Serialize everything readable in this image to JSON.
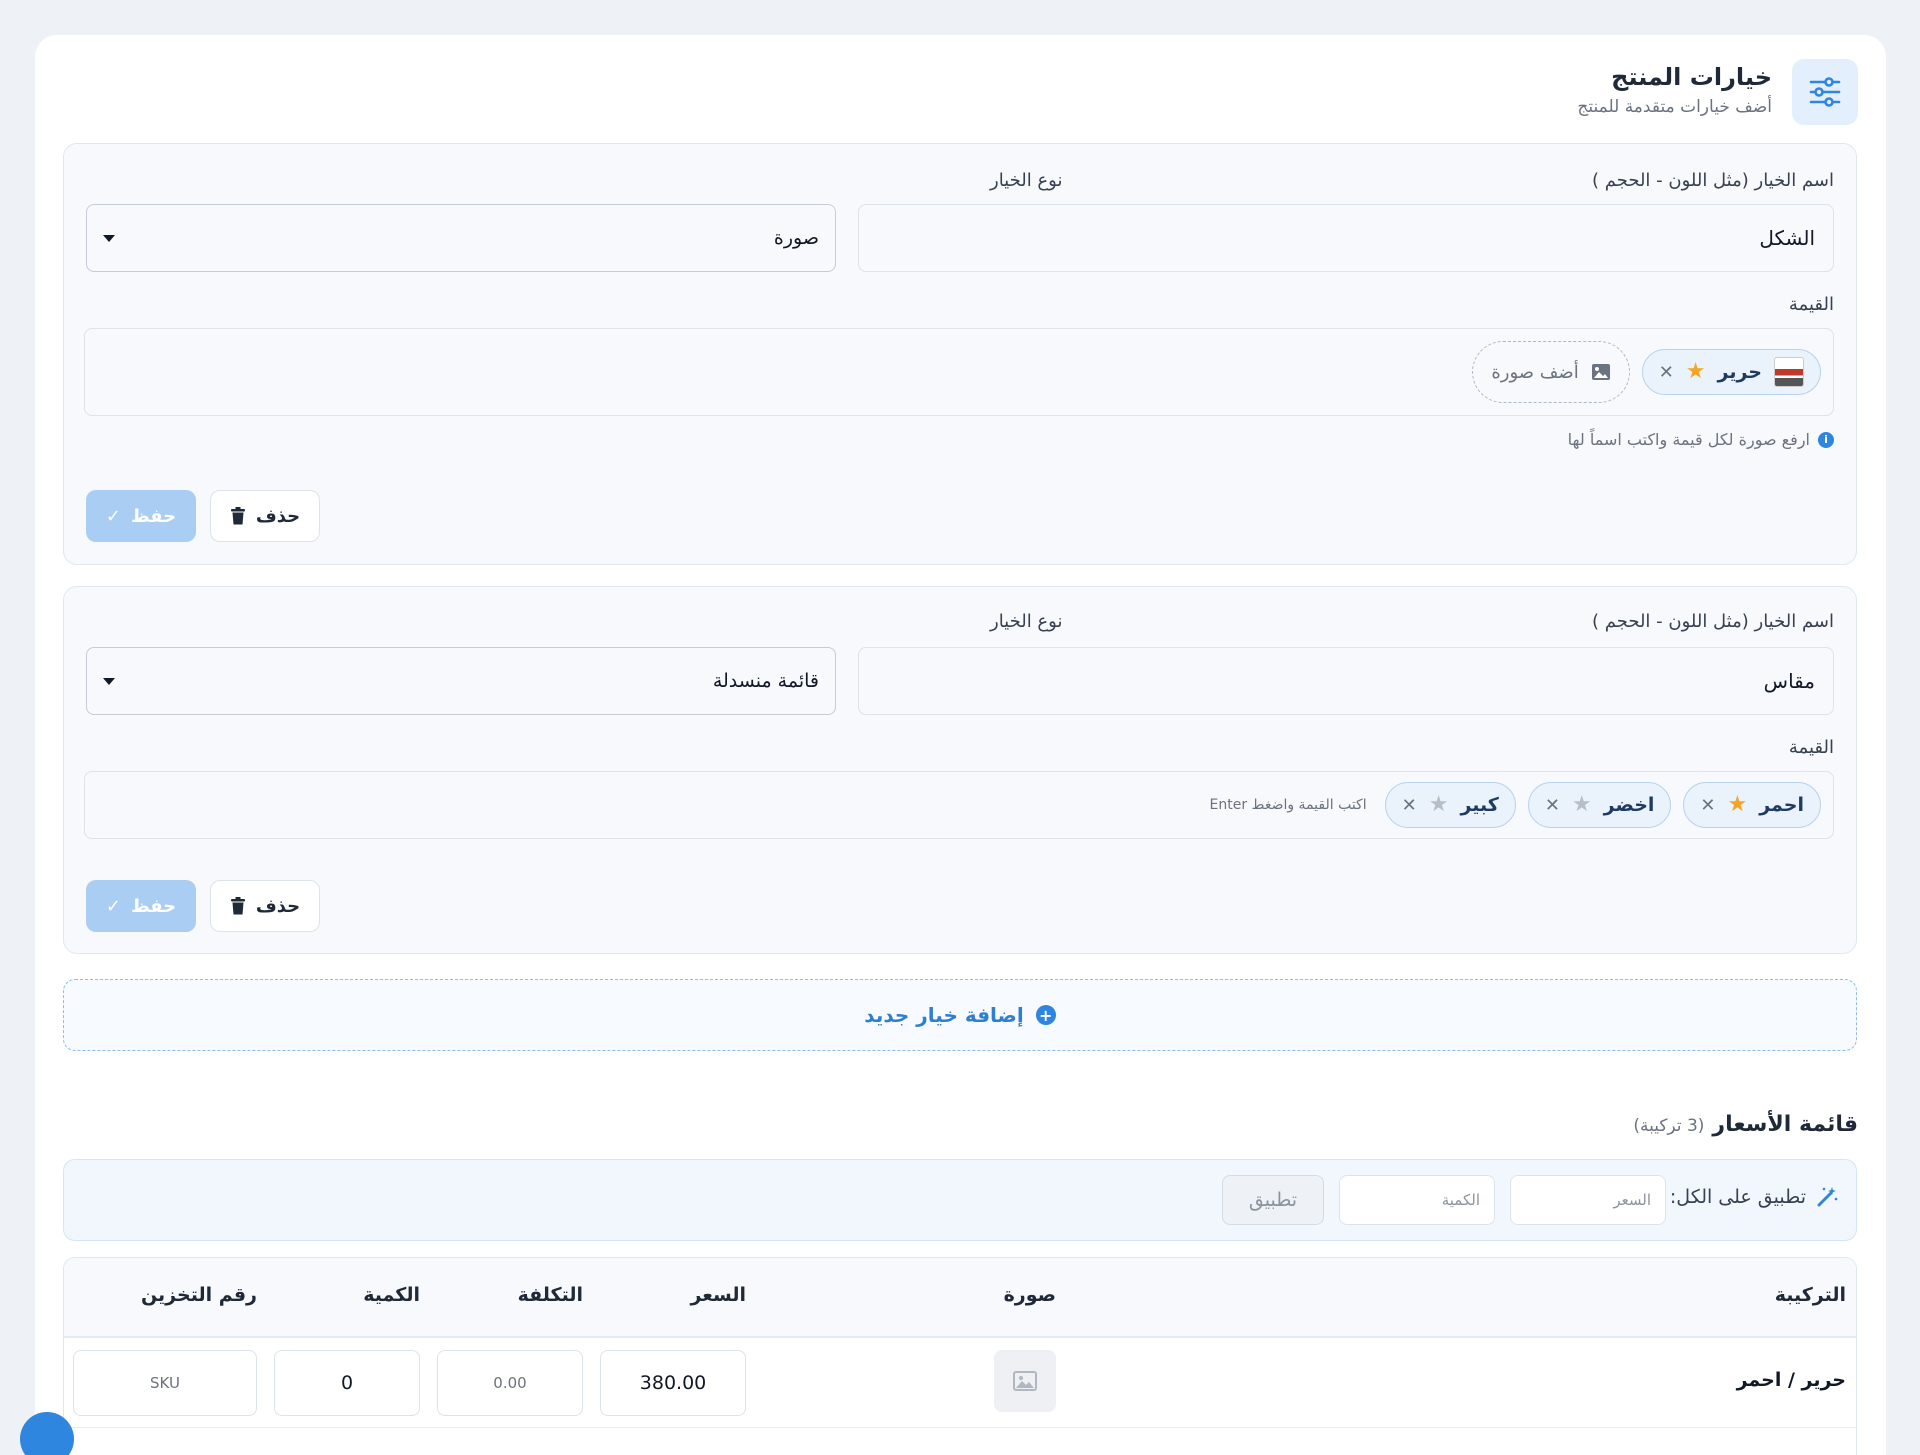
{
  "header": {
    "title": "خيارات المنتج",
    "subtitle": "أضف خيارات متقدمة للمنتج",
    "icon": "sliders-icon",
    "accent": "#2f86de"
  },
  "options": [
    {
      "name_label": "اسم الخيار (مثل اللون - الحجم )",
      "name_value": "الشكل",
      "type_label": "نوع الخيار",
      "type_value": "صورة",
      "values_label": "القيمة",
      "values": [
        {
          "text": "حرير",
          "starred": true
        }
      ],
      "add_image_label": "أضف صورة",
      "note": "ارفع صورة لكل قيمة واكتب اسماً لها",
      "delete_label": "حذف",
      "save_label": "حفظ"
    },
    {
      "name_label": "اسم الخيار (مثل اللون - الحجم )",
      "name_value": "مقاس",
      "type_label": "نوع الخيار",
      "type_value": "قائمة منسدلة",
      "values_label": "القيمة",
      "values": [
        {
          "text": "احمر",
          "starred": true
        },
        {
          "text": "اخضر",
          "starred": false
        },
        {
          "text": "كبير",
          "starred": false
        }
      ],
      "input_placeholder": "اكتب القيمة واضغط Enter",
      "delete_label": "حذف",
      "save_label": "حفظ"
    }
  ],
  "add_option_label": "إضافة خيار جديد",
  "price_list": {
    "title": "قائمة الأسعار",
    "count": "(3 تركيبة)",
    "apply_all_label": "تطبيق على الكل:",
    "price_placeholder": "السعر",
    "qty_placeholder": "الكمية",
    "apply_button": "تطبيق",
    "columns": [
      "التركيبة",
      "صورة",
      "السعر",
      "التكلفة",
      "الكمية",
      "رقم التخزين"
    ],
    "rows": [
      {
        "combination": "حرير / احمر",
        "price": "380.00",
        "cost": "0.00",
        "quantity": "0",
        "sku": "SKU"
      }
    ]
  }
}
